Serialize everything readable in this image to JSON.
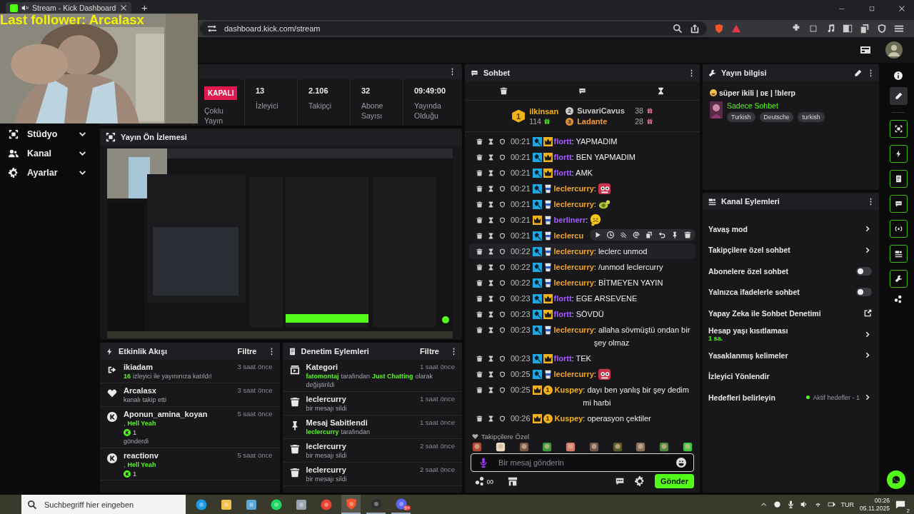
{
  "browser": {
    "tab_title": "Stream - Kick Dashboard",
    "new_tab": "+",
    "url": "dashboard.kick.com/stream"
  },
  "overlay": {
    "follower_text": "Last follower: Arcalasx"
  },
  "sidebar": {
    "items": [
      {
        "label": "Stüdyo",
        "kind": "studio",
        "expanded": false
      },
      {
        "label": "Kanal",
        "kind": "channel",
        "expanded": false
      },
      {
        "label": "Ayarlar",
        "kind": "settings",
        "expanded": false
      }
    ]
  },
  "stats": {
    "status": "KAPALI",
    "status_label": "Çoklu Yayın",
    "items": [
      {
        "value": "13",
        "label": "İzleyici"
      },
      {
        "value": "2.106",
        "label": "Takipçi"
      },
      {
        "value": "32",
        "label": "Abone Sayısı"
      },
      {
        "value": "09:49:00",
        "label": "Yayında Olduğu"
      }
    ]
  },
  "preview": {
    "title": "Yayın Ön İzlemesi"
  },
  "activity": {
    "title": "Etkinlik Akışı",
    "filter": "Filtre",
    "events": [
      {
        "kind": "host",
        "user": "ikiadam",
        "time": "3 saat önce",
        "detail": [
          {
            "text": "16",
            "highlight": true
          },
          {
            "text": "izleyici ile yayınınıza katıldı!",
            "highlight": false
          }
        ]
      },
      {
        "kind": "follow",
        "user": "Arcalasx",
        "time": "3 saat önce",
        "detail": [
          {
            "text": "kanalı takip etti",
            "highlight": false
          }
        ]
      },
      {
        "kind": "gift",
        "user": "Aponun_amina_koyan",
        "time": "5 saat önce",
        "detail": [
          {
            "text": ",",
            "highlight": false
          },
          {
            "text": "Hell Yeah",
            "highlight": true
          }
        ],
        "amount": "1",
        "note": "gönderdi"
      },
      {
        "kind": "gift",
        "user": "reactionv",
        "time": "5 saat önce",
        "detail": [
          {
            "text": ",",
            "highlight": false
          },
          {
            "text": "Hell Yeah",
            "highlight": true
          }
        ],
        "amount": "1"
      }
    ]
  },
  "moderation": {
    "title": "Denetim Eylemleri",
    "filter": "Filtre",
    "actions": [
      {
        "kind": "category",
        "title": "Kategori",
        "time": "1 saat önce",
        "detail": [
          {
            "text": "fatomontaj",
            "highlight": true
          },
          {
            "text": "tarafından",
            "highlight": false
          },
          {
            "text": "Just Chatting",
            "highlight": true
          },
          {
            "text": "olarak değiştirildi",
            "highlight": false
          }
        ]
      },
      {
        "kind": "delete",
        "title": "leclercurry",
        "time": "1 saat önce",
        "detail": [
          {
            "text": "bir mesajı sildi",
            "highlight": false
          }
        ]
      },
      {
        "kind": "pin",
        "title": "Mesaj Sabitlendi",
        "time": "1 saat önce",
        "detail": [
          {
            "text": "leclercurry",
            "highlight": true
          },
          {
            "text": "tarafından",
            "highlight": false
          }
        ]
      },
      {
        "kind": "delete",
        "title": "leclercurry",
        "time": "2 saat önce",
        "detail": [
          {
            "text": "bir mesajı sildi",
            "highlight": false
          }
        ]
      },
      {
        "kind": "delete",
        "title": "leclercurry",
        "time": "2 saat önce",
        "detail": [
          {
            "text": "bir mesajı sildi",
            "highlight": false
          }
        ]
      }
    ]
  },
  "chat": {
    "title": "Sohbet",
    "leaderboard": [
      {
        "rank": "1",
        "user": "ilkinsan",
        "count": "114"
      },
      {
        "rank": "2",
        "user": "SuvariCavus",
        "count": "38"
      },
      {
        "rank": "3",
        "user": "Ladante",
        "count": "28"
      }
    ],
    "messages": [
      {
        "time": "00:21",
        "badges": [
          {
            "kind": "mod"
          },
          {
            "kind": "crown"
          }
        ],
        "user": "flortt",
        "color": "#a35cff",
        "text": ": YAPMADIM",
        "hovered": false
      },
      {
        "time": "00:21",
        "badges": [
          {
            "kind": "mod"
          },
          {
            "kind": "crown"
          }
        ],
        "user": "flortt",
        "color": "#a35cff",
        "text": ": BEN YAPMADIM",
        "hovered": false
      },
      {
        "time": "00:21",
        "badges": [
          {
            "kind": "mod"
          },
          {
            "kind": "crown"
          }
        ],
        "user": "flortt",
        "color": "#a35cff",
        "text": ": AMK",
        "hovered": false
      },
      {
        "time": "00:21",
        "badges": [
          {
            "kind": "mod"
          },
          {
            "kind": "cup"
          }
        ],
        "user": "leclercurry",
        "color": "#f5a524",
        "text": ":",
        "emote": {
          "kind": "red-blob"
        },
        "hovered": false
      },
      {
        "time": "00:21",
        "badges": [
          {
            "kind": "mod"
          },
          {
            "kind": "cup"
          }
        ],
        "user": "leclercurry",
        "color": "#f5a524",
        "text": ":",
        "emote": {
          "kind": "turtle"
        },
        "hovered": false
      },
      {
        "time": "00:21",
        "badges": [
          {
            "kind": "crown"
          },
          {
            "kind": "cup"
          }
        ],
        "user": "berlinerr",
        "color": "#a35cff",
        "text": ":",
        "emote": {
          "kind": "yellow-face"
        },
        "hovered": false
      },
      {
        "time": "00:21",
        "badges": [
          {
            "kind": "mod"
          },
          {
            "kind": "cup"
          }
        ],
        "user": "leclercu",
        "color": "#f5a524",
        "hovered": false
      },
      {
        "time": "00:22",
        "badges": [
          {
            "kind": "mod"
          },
          {
            "kind": "cup"
          }
        ],
        "user": "leclercurry",
        "color": "#f5a524",
        "text": ": leclerc unmod",
        "hovered": true
      },
      {
        "time": "00:22",
        "badges": [
          {
            "kind": "mod"
          },
          {
            "kind": "cup"
          }
        ],
        "user": "leclercurry",
        "color": "#f5a524",
        "text": ": /unmod leclercurry",
        "hovered": false
      },
      {
        "time": "00:22",
        "badges": [
          {
            "kind": "mod"
          },
          {
            "kind": "cup"
          }
        ],
        "user": "leclercurry",
        "color": "#f5a524",
        "text": ": BİTMEYEN YAYIN",
        "hovered": false
      },
      {
        "time": "00:23",
        "badges": [
          {
            "kind": "mod"
          },
          {
            "kind": "crown"
          }
        ],
        "user": "flortt",
        "color": "#a35cff",
        "text": ": EGE ARSEVENE",
        "hovered": false
      },
      {
        "time": "00:23",
        "badges": [
          {
            "kind": "mod"
          },
          {
            "kind": "crown"
          }
        ],
        "user": "flortt",
        "color": "#a35cff",
        "text": ": SÖVDÜ",
        "hovered": false
      },
      {
        "time": "00:23",
        "badges": [
          {
            "kind": "mod"
          },
          {
            "kind": "cup"
          }
        ],
        "user": "leclercurry",
        "color": "#f5a524",
        "text": ": allaha sövmüştü ondan bir şey olmaz",
        "hovered": false
      },
      {
        "time": "00:23",
        "badges": [
          {
            "kind": "mod"
          },
          {
            "kind": "crown"
          }
        ],
        "user": "flortt",
        "color": "#a35cff",
        "text": ": TEK",
        "hovered": false
      },
      {
        "time": "00:25",
        "badges": [
          {
            "kind": "mod"
          },
          {
            "kind": "cup"
          }
        ],
        "user": "leclercurry",
        "color": "#f5a524",
        "text": ":",
        "emote": {
          "kind": "red-blob"
        },
        "hovered": false
      },
      {
        "time": "00:25",
        "badges": [
          {
            "kind": "crown"
          },
          {
            "kind": "sub",
            "label": "1"
          }
        ],
        "user": "Kuspey",
        "color": "#f2b318",
        "text": ": dayı ben yanlış bir şey dedim mi harbi",
        "hovered": false
      },
      {
        "time": "00:26",
        "badges": [
          {
            "kind": "crown"
          },
          {
            "kind": "sub",
            "label": "1"
          }
        ],
        "user": "Kuspey",
        "color": "#f2b318",
        "text": ": operasyon çektiler",
        "hovered": false
      }
    ],
    "emote_section": "Takipçilere Özel",
    "input": {
      "placeholder": "Bir mesaj gönderin"
    },
    "points": "∞",
    "send": "Gönder"
  },
  "stream_info": {
    "title": "Yayın bilgisi",
    "stream_title": "süper ikili | ᴅᴇ | !blerp",
    "category": "Sadece Sohbet",
    "tags": [
      "Turkish",
      "Deutsche",
      "turkish"
    ]
  },
  "channel_actions": {
    "title": "Kanal Eylemleri",
    "items": [
      {
        "kind": "link",
        "label": "Yavaş mod"
      },
      {
        "kind": "link",
        "label": "Takipçilere özel sohbet"
      },
      {
        "kind": "toggle",
        "label": "Abonelere özel sohbet",
        "on": false
      },
      {
        "kind": "toggle",
        "label": "Yalnızca ifadelerle sohbet",
        "on": false
      },
      {
        "kind": "external",
        "label": "Yapay Zeka ile Sohbet Denetimi"
      },
      {
        "kind": "link",
        "label": "Hesap yaşı kısıtlaması",
        "value": "1 sa."
      },
      {
        "kind": "link",
        "label": "Yasaklanmış kelimeler"
      },
      {
        "kind": "plain",
        "label": "İzleyici Yönlendir"
      },
      {
        "kind": "link",
        "label": "Hedefleri belirleyin",
        "status": "Aktif hedefler - 1"
      }
    ]
  },
  "rail": {
    "items": [
      {
        "kind": "info",
        "selected": false,
        "pinned": false
      },
      {
        "kind": "edit",
        "selected": true,
        "pinned": false
      },
      {
        "kind": "studio",
        "selected": false,
        "pinned": true
      },
      {
        "kind": "bolt",
        "selected": false,
        "pinned": true
      },
      {
        "kind": "note",
        "selected": false,
        "pinned": true
      },
      {
        "kind": "chat",
        "selected": false,
        "pinned": true
      },
      {
        "kind": "broadcast",
        "selected": false,
        "pinned": true
      },
      {
        "kind": "channel",
        "selected": false,
        "pinned": true
      },
      {
        "kind": "wrench",
        "selected": false,
        "pinned": true
      },
      {
        "kind": "kick",
        "selected": false,
        "pinned": false
      }
    ]
  },
  "taskbar": {
    "search_placeholder": "Suchbegriff hier eingeben",
    "apps": [
      {
        "kind": "edge",
        "selected": false,
        "running": false
      },
      {
        "kind": "files",
        "selected": false,
        "running": false
      },
      {
        "kind": "photos",
        "selected": false,
        "running": false
      },
      {
        "kind": "spotify",
        "selected": false,
        "running": false
      },
      {
        "kind": "calc",
        "selected": false,
        "running": false
      },
      {
        "kind": "chrome",
        "selected": false,
        "running": false
      },
      {
        "kind": "brave",
        "selected": true,
        "running": true
      },
      {
        "kind": "obs",
        "selected": false,
        "running": true
      },
      {
        "kind": "discord",
        "selected": false,
        "running": true,
        "badge": "9+"
      }
    ],
    "language": "TUR",
    "time": "00:26",
    "date": "05.11.2025",
    "notifications": "2"
  }
}
